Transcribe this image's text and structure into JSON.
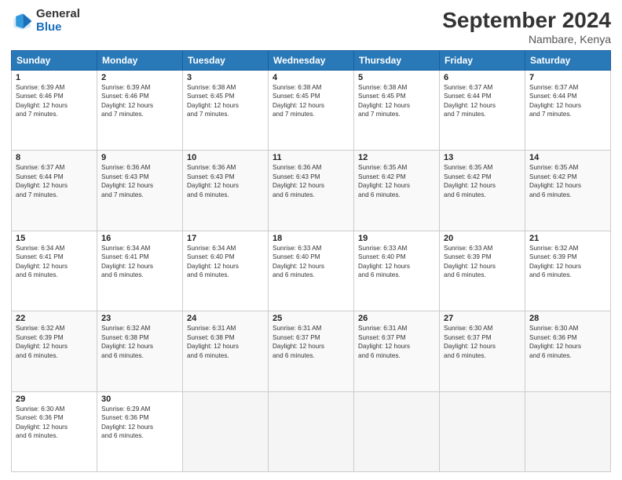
{
  "logo": {
    "general": "General",
    "blue": "Blue"
  },
  "header": {
    "month": "September 2024",
    "location": "Nambare, Kenya"
  },
  "days": [
    "Sunday",
    "Monday",
    "Tuesday",
    "Wednesday",
    "Thursday",
    "Friday",
    "Saturday"
  ],
  "weeks": [
    [
      {
        "num": "1",
        "lines": [
          "Sunrise: 6:39 AM",
          "Sunset: 6:46 PM",
          "Daylight: 12 hours",
          "and 7 minutes."
        ]
      },
      {
        "num": "2",
        "lines": [
          "Sunrise: 6:39 AM",
          "Sunset: 6:46 PM",
          "Daylight: 12 hours",
          "and 7 minutes."
        ]
      },
      {
        "num": "3",
        "lines": [
          "Sunrise: 6:38 AM",
          "Sunset: 6:45 PM",
          "Daylight: 12 hours",
          "and 7 minutes."
        ]
      },
      {
        "num": "4",
        "lines": [
          "Sunrise: 6:38 AM",
          "Sunset: 6:45 PM",
          "Daylight: 12 hours",
          "and 7 minutes."
        ]
      },
      {
        "num": "5",
        "lines": [
          "Sunrise: 6:38 AM",
          "Sunset: 6:45 PM",
          "Daylight: 12 hours",
          "and 7 minutes."
        ]
      },
      {
        "num": "6",
        "lines": [
          "Sunrise: 6:37 AM",
          "Sunset: 6:44 PM",
          "Daylight: 12 hours",
          "and 7 minutes."
        ]
      },
      {
        "num": "7",
        "lines": [
          "Sunrise: 6:37 AM",
          "Sunset: 6:44 PM",
          "Daylight: 12 hours",
          "and 7 minutes."
        ]
      }
    ],
    [
      {
        "num": "8",
        "lines": [
          "Sunrise: 6:37 AM",
          "Sunset: 6:44 PM",
          "Daylight: 12 hours",
          "and 7 minutes."
        ]
      },
      {
        "num": "9",
        "lines": [
          "Sunrise: 6:36 AM",
          "Sunset: 6:43 PM",
          "Daylight: 12 hours",
          "and 7 minutes."
        ]
      },
      {
        "num": "10",
        "lines": [
          "Sunrise: 6:36 AM",
          "Sunset: 6:43 PM",
          "Daylight: 12 hours",
          "and 6 minutes."
        ]
      },
      {
        "num": "11",
        "lines": [
          "Sunrise: 6:36 AM",
          "Sunset: 6:43 PM",
          "Daylight: 12 hours",
          "and 6 minutes."
        ]
      },
      {
        "num": "12",
        "lines": [
          "Sunrise: 6:35 AM",
          "Sunset: 6:42 PM",
          "Daylight: 12 hours",
          "and 6 minutes."
        ]
      },
      {
        "num": "13",
        "lines": [
          "Sunrise: 6:35 AM",
          "Sunset: 6:42 PM",
          "Daylight: 12 hours",
          "and 6 minutes."
        ]
      },
      {
        "num": "14",
        "lines": [
          "Sunrise: 6:35 AM",
          "Sunset: 6:42 PM",
          "Daylight: 12 hours",
          "and 6 minutes."
        ]
      }
    ],
    [
      {
        "num": "15",
        "lines": [
          "Sunrise: 6:34 AM",
          "Sunset: 6:41 PM",
          "Daylight: 12 hours",
          "and 6 minutes."
        ]
      },
      {
        "num": "16",
        "lines": [
          "Sunrise: 6:34 AM",
          "Sunset: 6:41 PM",
          "Daylight: 12 hours",
          "and 6 minutes."
        ]
      },
      {
        "num": "17",
        "lines": [
          "Sunrise: 6:34 AM",
          "Sunset: 6:40 PM",
          "Daylight: 12 hours",
          "and 6 minutes."
        ]
      },
      {
        "num": "18",
        "lines": [
          "Sunrise: 6:33 AM",
          "Sunset: 6:40 PM",
          "Daylight: 12 hours",
          "and 6 minutes."
        ]
      },
      {
        "num": "19",
        "lines": [
          "Sunrise: 6:33 AM",
          "Sunset: 6:40 PM",
          "Daylight: 12 hours",
          "and 6 minutes."
        ]
      },
      {
        "num": "20",
        "lines": [
          "Sunrise: 6:33 AM",
          "Sunset: 6:39 PM",
          "Daylight: 12 hours",
          "and 6 minutes."
        ]
      },
      {
        "num": "21",
        "lines": [
          "Sunrise: 6:32 AM",
          "Sunset: 6:39 PM",
          "Daylight: 12 hours",
          "and 6 minutes."
        ]
      }
    ],
    [
      {
        "num": "22",
        "lines": [
          "Sunrise: 6:32 AM",
          "Sunset: 6:39 PM",
          "Daylight: 12 hours",
          "and 6 minutes."
        ]
      },
      {
        "num": "23",
        "lines": [
          "Sunrise: 6:32 AM",
          "Sunset: 6:38 PM",
          "Daylight: 12 hours",
          "and 6 minutes."
        ]
      },
      {
        "num": "24",
        "lines": [
          "Sunrise: 6:31 AM",
          "Sunset: 6:38 PM",
          "Daylight: 12 hours",
          "and 6 minutes."
        ]
      },
      {
        "num": "25",
        "lines": [
          "Sunrise: 6:31 AM",
          "Sunset: 6:37 PM",
          "Daylight: 12 hours",
          "and 6 minutes."
        ]
      },
      {
        "num": "26",
        "lines": [
          "Sunrise: 6:31 AM",
          "Sunset: 6:37 PM",
          "Daylight: 12 hours",
          "and 6 minutes."
        ]
      },
      {
        "num": "27",
        "lines": [
          "Sunrise: 6:30 AM",
          "Sunset: 6:37 PM",
          "Daylight: 12 hours",
          "and 6 minutes."
        ]
      },
      {
        "num": "28",
        "lines": [
          "Sunrise: 6:30 AM",
          "Sunset: 6:36 PM",
          "Daylight: 12 hours",
          "and 6 minutes."
        ]
      }
    ],
    [
      {
        "num": "29",
        "lines": [
          "Sunrise: 6:30 AM",
          "Sunset: 6:36 PM",
          "Daylight: 12 hours",
          "and 6 minutes."
        ]
      },
      {
        "num": "30",
        "lines": [
          "Sunrise: 6:29 AM",
          "Sunset: 6:36 PM",
          "Daylight: 12 hours",
          "and 6 minutes."
        ]
      },
      null,
      null,
      null,
      null,
      null
    ]
  ]
}
